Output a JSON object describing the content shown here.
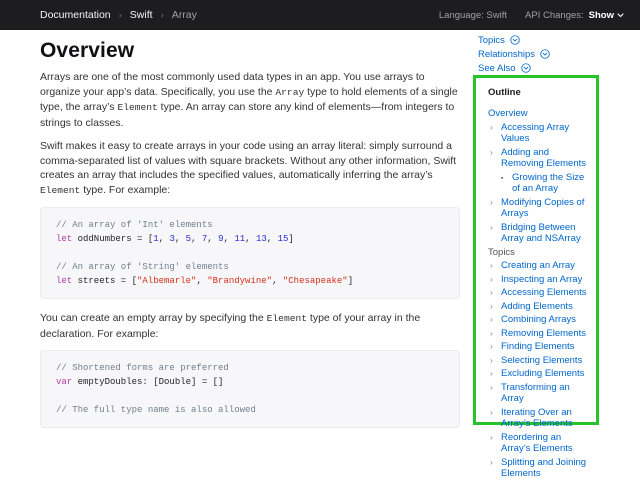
{
  "nav": {
    "breadcrumbs": [
      "Documentation",
      "Swift",
      "Array"
    ],
    "separator": "›",
    "language_label": "Language: Swift",
    "api_changes_label": "API Changes:",
    "api_changes_value": "Show"
  },
  "main": {
    "heading": "Overview",
    "para1": [
      {
        "t": "text",
        "v": "Arrays are one of the most commonly used data types in an app. You use arrays to organize your app’s data. Specifically, you use the "
      },
      {
        "t": "code",
        "v": "Array"
      },
      {
        "t": "text",
        "v": " type to hold elements of a single type, the array’s "
      },
      {
        "t": "code",
        "v": "Element"
      },
      {
        "t": "text",
        "v": " type. An array can store any kind of elements—from integers to strings to classes."
      }
    ],
    "para2": [
      {
        "t": "text",
        "v": "Swift makes it easy to create arrays in your code using an array literal: simply surround a comma-separated list of values with square brackets. Without any other information, Swift creates an array that includes the specified values, automatically inferring the array’s "
      },
      {
        "t": "code",
        "v": "Element"
      },
      {
        "t": "text",
        "v": " type. For example:"
      }
    ],
    "code1": [
      [
        {
          "c": "c",
          "v": "// An array of 'Int' elements"
        }
      ],
      [
        {
          "c": "k",
          "v": "let"
        },
        {
          "c": "p",
          "v": " oddNumbers = ["
        },
        {
          "c": "n",
          "v": "1"
        },
        {
          "c": "p",
          "v": ", "
        },
        {
          "c": "n",
          "v": "3"
        },
        {
          "c": "p",
          "v": ", "
        },
        {
          "c": "n",
          "v": "5"
        },
        {
          "c": "p",
          "v": ", "
        },
        {
          "c": "n",
          "v": "7"
        },
        {
          "c": "p",
          "v": ", "
        },
        {
          "c": "n",
          "v": "9"
        },
        {
          "c": "p",
          "v": ", "
        },
        {
          "c": "n",
          "v": "11"
        },
        {
          "c": "p",
          "v": ", "
        },
        {
          "c": "n",
          "v": "13"
        },
        {
          "c": "p",
          "v": ", "
        },
        {
          "c": "n",
          "v": "15"
        },
        {
          "c": "p",
          "v": "]"
        }
      ],
      [],
      [
        {
          "c": "c",
          "v": "// An array of 'String' elements"
        }
      ],
      [
        {
          "c": "k",
          "v": "let"
        },
        {
          "c": "p",
          "v": " streets = ["
        },
        {
          "c": "s",
          "v": "\"Albemarle\""
        },
        {
          "c": "p",
          "v": ", "
        },
        {
          "c": "s",
          "v": "\"Brandywine\""
        },
        {
          "c": "p",
          "v": ", "
        },
        {
          "c": "s",
          "v": "\"Chesapeake\""
        },
        {
          "c": "p",
          "v": "]"
        }
      ]
    ],
    "para3": [
      {
        "t": "text",
        "v": "You can create an empty array by specifying the "
      },
      {
        "t": "code",
        "v": "Element"
      },
      {
        "t": "text",
        "v": " type of your array in the declaration. For example:"
      }
    ],
    "code2": [
      [
        {
          "c": "c",
          "v": "// Shortened forms are preferred"
        }
      ],
      [
        {
          "c": "k",
          "v": "var"
        },
        {
          "c": "p",
          "v": " emptyDoubles: [Double] = []"
        }
      ],
      [],
      [
        {
          "c": "c",
          "v": "// The full type name is also allowed"
        }
      ]
    ]
  },
  "sidebar": {
    "section_links": [
      {
        "label": "Topics"
      },
      {
        "label": "Relationships"
      },
      {
        "label": "See Also"
      }
    ],
    "outline": {
      "title": "Outline",
      "items": [
        {
          "label": "Overview",
          "indent": 0,
          "type": "link",
          "marker": ""
        },
        {
          "label": "Accessing Array Values",
          "indent": 1,
          "type": "link",
          "marker": "›"
        },
        {
          "label": "Adding and Removing Elements",
          "indent": 1,
          "type": "link",
          "marker": "›"
        },
        {
          "label": "Growing the Size of an Array",
          "indent": 2,
          "type": "link",
          "marker": "▪"
        },
        {
          "label": "Modifying Copies of Arrays",
          "indent": 1,
          "type": "link",
          "marker": "›"
        },
        {
          "label": "Bridging Between Array and NSArray",
          "indent": 1,
          "type": "link",
          "marker": "›"
        },
        {
          "label": "Topics",
          "indent": 0,
          "type": "header",
          "marker": ""
        },
        {
          "label": "Creating an Array",
          "indent": 1,
          "type": "link",
          "marker": "›"
        },
        {
          "label": "Inspecting an Array",
          "indent": 1,
          "type": "link",
          "marker": "›"
        },
        {
          "label": "Accessing Elements",
          "indent": 1,
          "type": "link",
          "marker": "›"
        },
        {
          "label": "Adding Elements",
          "indent": 1,
          "type": "link",
          "marker": "›"
        },
        {
          "label": "Combining Arrays",
          "indent": 1,
          "type": "link",
          "marker": "›"
        },
        {
          "label": "Removing Elements",
          "indent": 1,
          "type": "link",
          "marker": "›"
        },
        {
          "label": "Finding Elements",
          "indent": 1,
          "type": "link",
          "marker": "›"
        },
        {
          "label": "Selecting Elements",
          "indent": 1,
          "type": "link",
          "marker": "›"
        },
        {
          "label": "Excluding Elements",
          "indent": 1,
          "type": "link",
          "marker": "›"
        },
        {
          "label": "Transforming an Array",
          "indent": 1,
          "type": "link",
          "marker": "›"
        },
        {
          "label": "Iterating Over an Array’s Elements",
          "indent": 1,
          "type": "link",
          "marker": "›"
        },
        {
          "label": "Reordering an Array’s Elements",
          "indent": 1,
          "type": "link",
          "marker": "›"
        },
        {
          "label": "Splitting and Joining Elements",
          "indent": 1,
          "type": "link",
          "marker": "›"
        }
      ]
    }
  },
  "colors": {
    "nav_background": "#1d1d1f",
    "link_blue": "#0066cc",
    "highlight_green": "#26c32b",
    "code_background": "#f7f7f9",
    "code_comment": "#707f8c",
    "code_keyword": "#ad3da4",
    "code_number": "#272ad8",
    "code_string": "#d12f1b"
  }
}
